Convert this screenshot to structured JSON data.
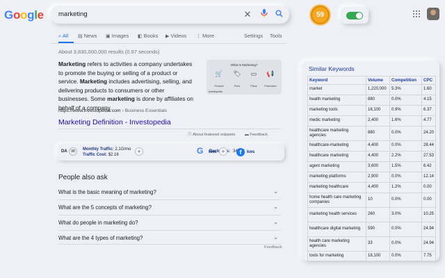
{
  "logo": {
    "letters": [
      "G",
      "o",
      "o",
      "g",
      "l",
      "e"
    ],
    "colors": [
      "#4285f4",
      "#ea4335",
      "#fbbc05",
      "#4285f4",
      "#34a853",
      "#ea4335"
    ]
  },
  "search": {
    "query": "marketing",
    "clear_icon": "close-icon",
    "mic_icon": "mic-icon",
    "search_icon": "search-icon"
  },
  "extension": {
    "score": "59",
    "toggle_on": true
  },
  "header": {
    "apps_icon": "apps-grid-icon",
    "avatar": "user-avatar"
  },
  "tabs": [
    {
      "icon": "⌕",
      "label": "All",
      "active": true
    },
    {
      "icon": "▤",
      "label": "News"
    },
    {
      "icon": "▣",
      "label": "Images"
    },
    {
      "icon": "◧",
      "label": "Books"
    },
    {
      "icon": "▶",
      "label": "Videos"
    },
    {
      "icon": "⋮",
      "label": "More"
    }
  ],
  "tools": {
    "settings": "Settings",
    "tools": "Tools"
  },
  "result_stats": "About 3,830,000,000 results (0.97 seconds)",
  "snippet": {
    "parts": [
      {
        "b": "Marketing"
      },
      {
        "t": " refers to activities a company undertakes to promote the buying or selling of a product or service. "
      },
      {
        "b": "Marketing"
      },
      {
        "t": " includes advertising, selling, and delivering products to consumers or other businesses. Some "
      },
      {
        "b": "marketing"
      },
      {
        "t": " is done by affiliates on behalf of a company."
      }
    ],
    "image": {
      "title": "What Is Marketing?",
      "labels": [
        "Product",
        "Price",
        "Place",
        "Promotion"
      ],
      "brand": "Investopedia"
    }
  },
  "result": {
    "url": "https://www.investopedia.com",
    "more": "›",
    "crumb": "Business Essentials",
    "title": "Marketing Definition - Investopedia"
  },
  "featured": {
    "about": "About featured snippets",
    "feedback": "Feedback"
  },
  "seo_bar": {
    "da_label": "DA",
    "da_value": "98",
    "traffic_label": "Monthly Traffic:",
    "traffic_value": "2.1G/mo",
    "cost_label": "Traffic Cost:",
    "cost_value": "$2.16",
    "backlinks_label": "Backlinks:",
    "backlinks_value": "34.4M",
    "kws_label": "kws"
  },
  "paa": {
    "title": "People also ask",
    "questions": [
      "What is the basic meaning of marketing?",
      "What are the 5 concepts of marketing?",
      "What do people in marketing do?",
      "What are the 4 types of marketing?"
    ],
    "feedback": "Feedback"
  },
  "keywords": {
    "title": "Similar Keywords",
    "headers": [
      "Keyword",
      "Volume",
      "Competition",
      "CPC"
    ],
    "rows": [
      [
        "market",
        "1,220,000",
        "5.3%",
        "1.60"
      ],
      [
        "health marketing",
        "880",
        "0.0%",
        "4.15"
      ],
      [
        "marketing tools",
        "18,100",
        "0.9%",
        "6.37"
      ],
      [
        "medic marketing",
        "2,400",
        "1.6%",
        "4.77"
      ],
      [
        "healthcare marketing agencies",
        "880",
        "0.0%",
        "24.20"
      ],
      [
        "healthcare-marketing",
        "4,400",
        "0.0%",
        "28.44"
      ],
      [
        "healthcare marketing",
        "4,400",
        "2.2%",
        "27.53"
      ],
      [
        "agent marketing",
        "3,600",
        "1.5%",
        "6.42"
      ],
      [
        "marketing platforms",
        "2,900",
        "0.0%",
        "12.14"
      ],
      [
        "marketing healthcare",
        "4,400",
        "1.2%",
        "0.00"
      ],
      [
        "home health care marketing companies",
        "10",
        "0.0%",
        "0.00"
      ],
      [
        "marketing health services",
        "260",
        "3.0%",
        "10.25"
      ],
      [
        "healthcare digital marketing",
        "590",
        "0.0%",
        "24.94"
      ],
      [
        "health care marketing agencies",
        "33",
        "0.0%",
        "24.94"
      ],
      [
        "tools for marketing",
        "18,100",
        "0.0%",
        "7.75"
      ]
    ]
  }
}
